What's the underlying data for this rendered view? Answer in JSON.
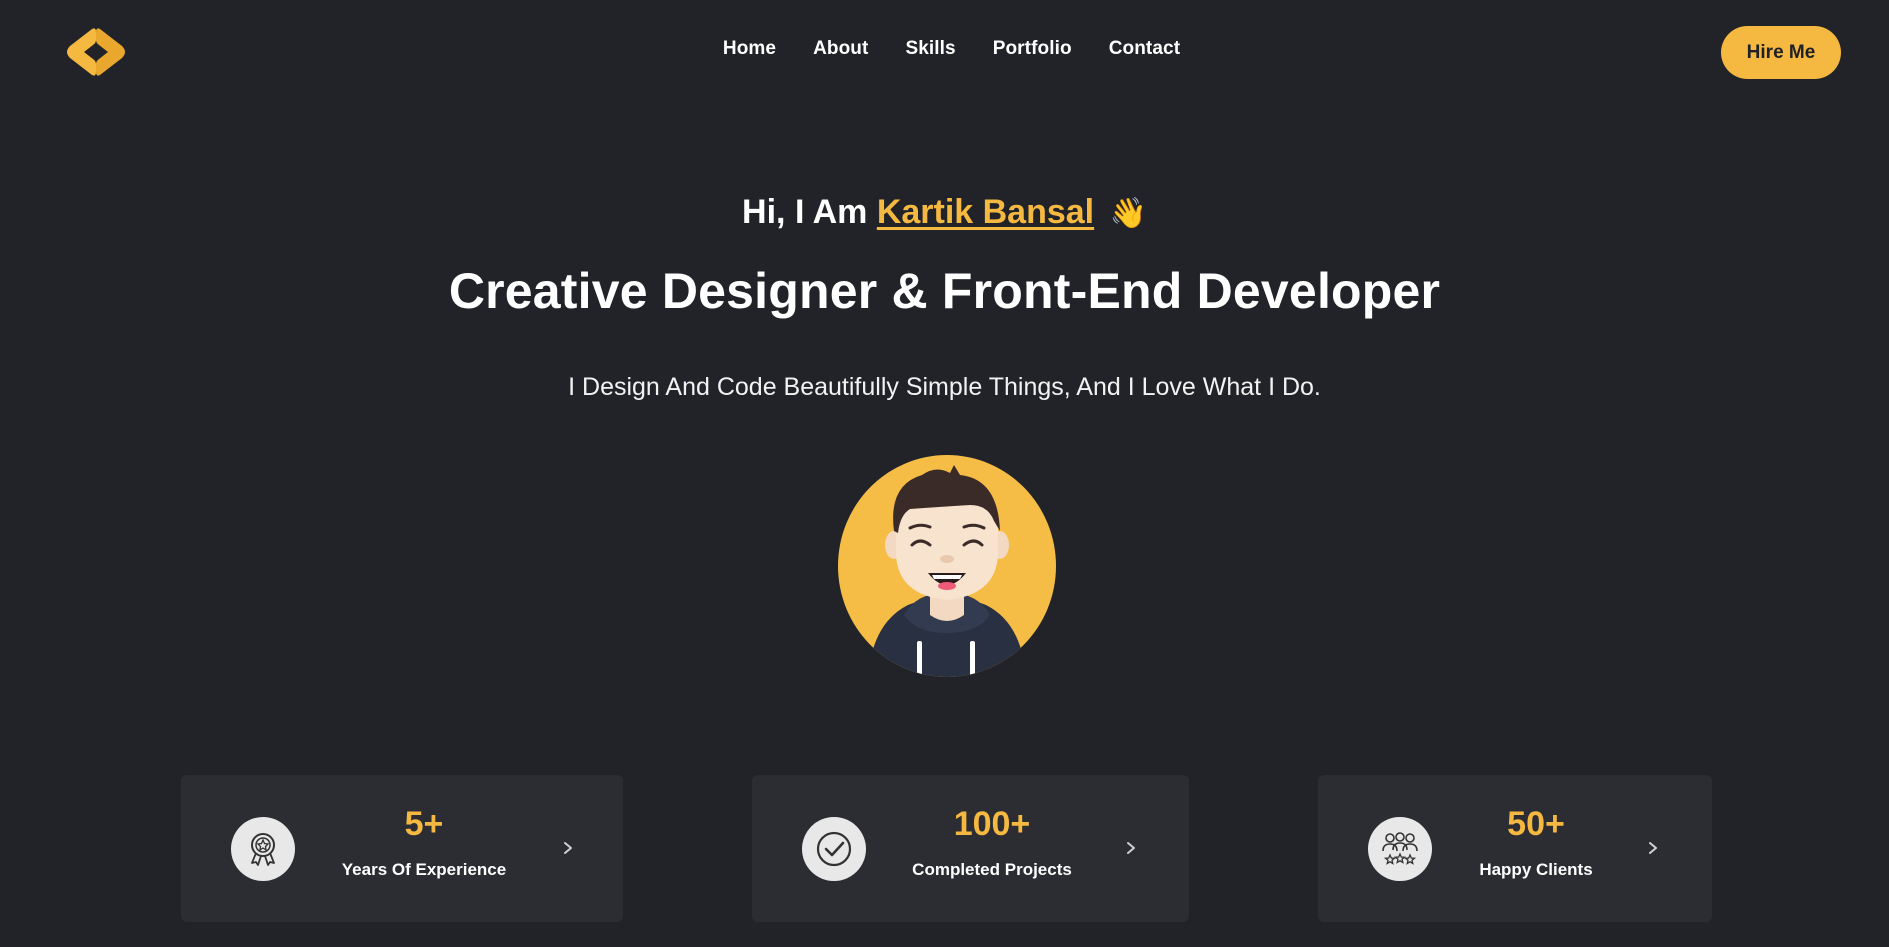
{
  "header": {
    "logo_icon": "code-brackets-logo-icon",
    "nav": [
      "Home",
      "About",
      "Skills",
      "Portfolio",
      "Contact"
    ],
    "cta_label": "Hire Me"
  },
  "hero": {
    "greeting_prefix": "Hi, I Am",
    "name": "Kartik Bansal",
    "wave_emoji": "👋",
    "headline": "Creative Designer & Front-End Developer",
    "tagline": "I Design And Code Beautifully Simple Things, And I Love What I Do.",
    "avatar_icon": "avatar-illustration"
  },
  "stats": [
    {
      "icon": "award-badge-icon",
      "value": "5+",
      "label": "Years Of Experience"
    },
    {
      "icon": "check-circle-icon",
      "value": "100+",
      "label": "Completed Projects"
    },
    {
      "icon": "group-stars-icon",
      "value": "50+",
      "label": "Happy Clients"
    }
  ],
  "colors": {
    "background": "#212328",
    "card": "#2b2d33",
    "accent": "#f5b840",
    "text": "#ffffff"
  }
}
